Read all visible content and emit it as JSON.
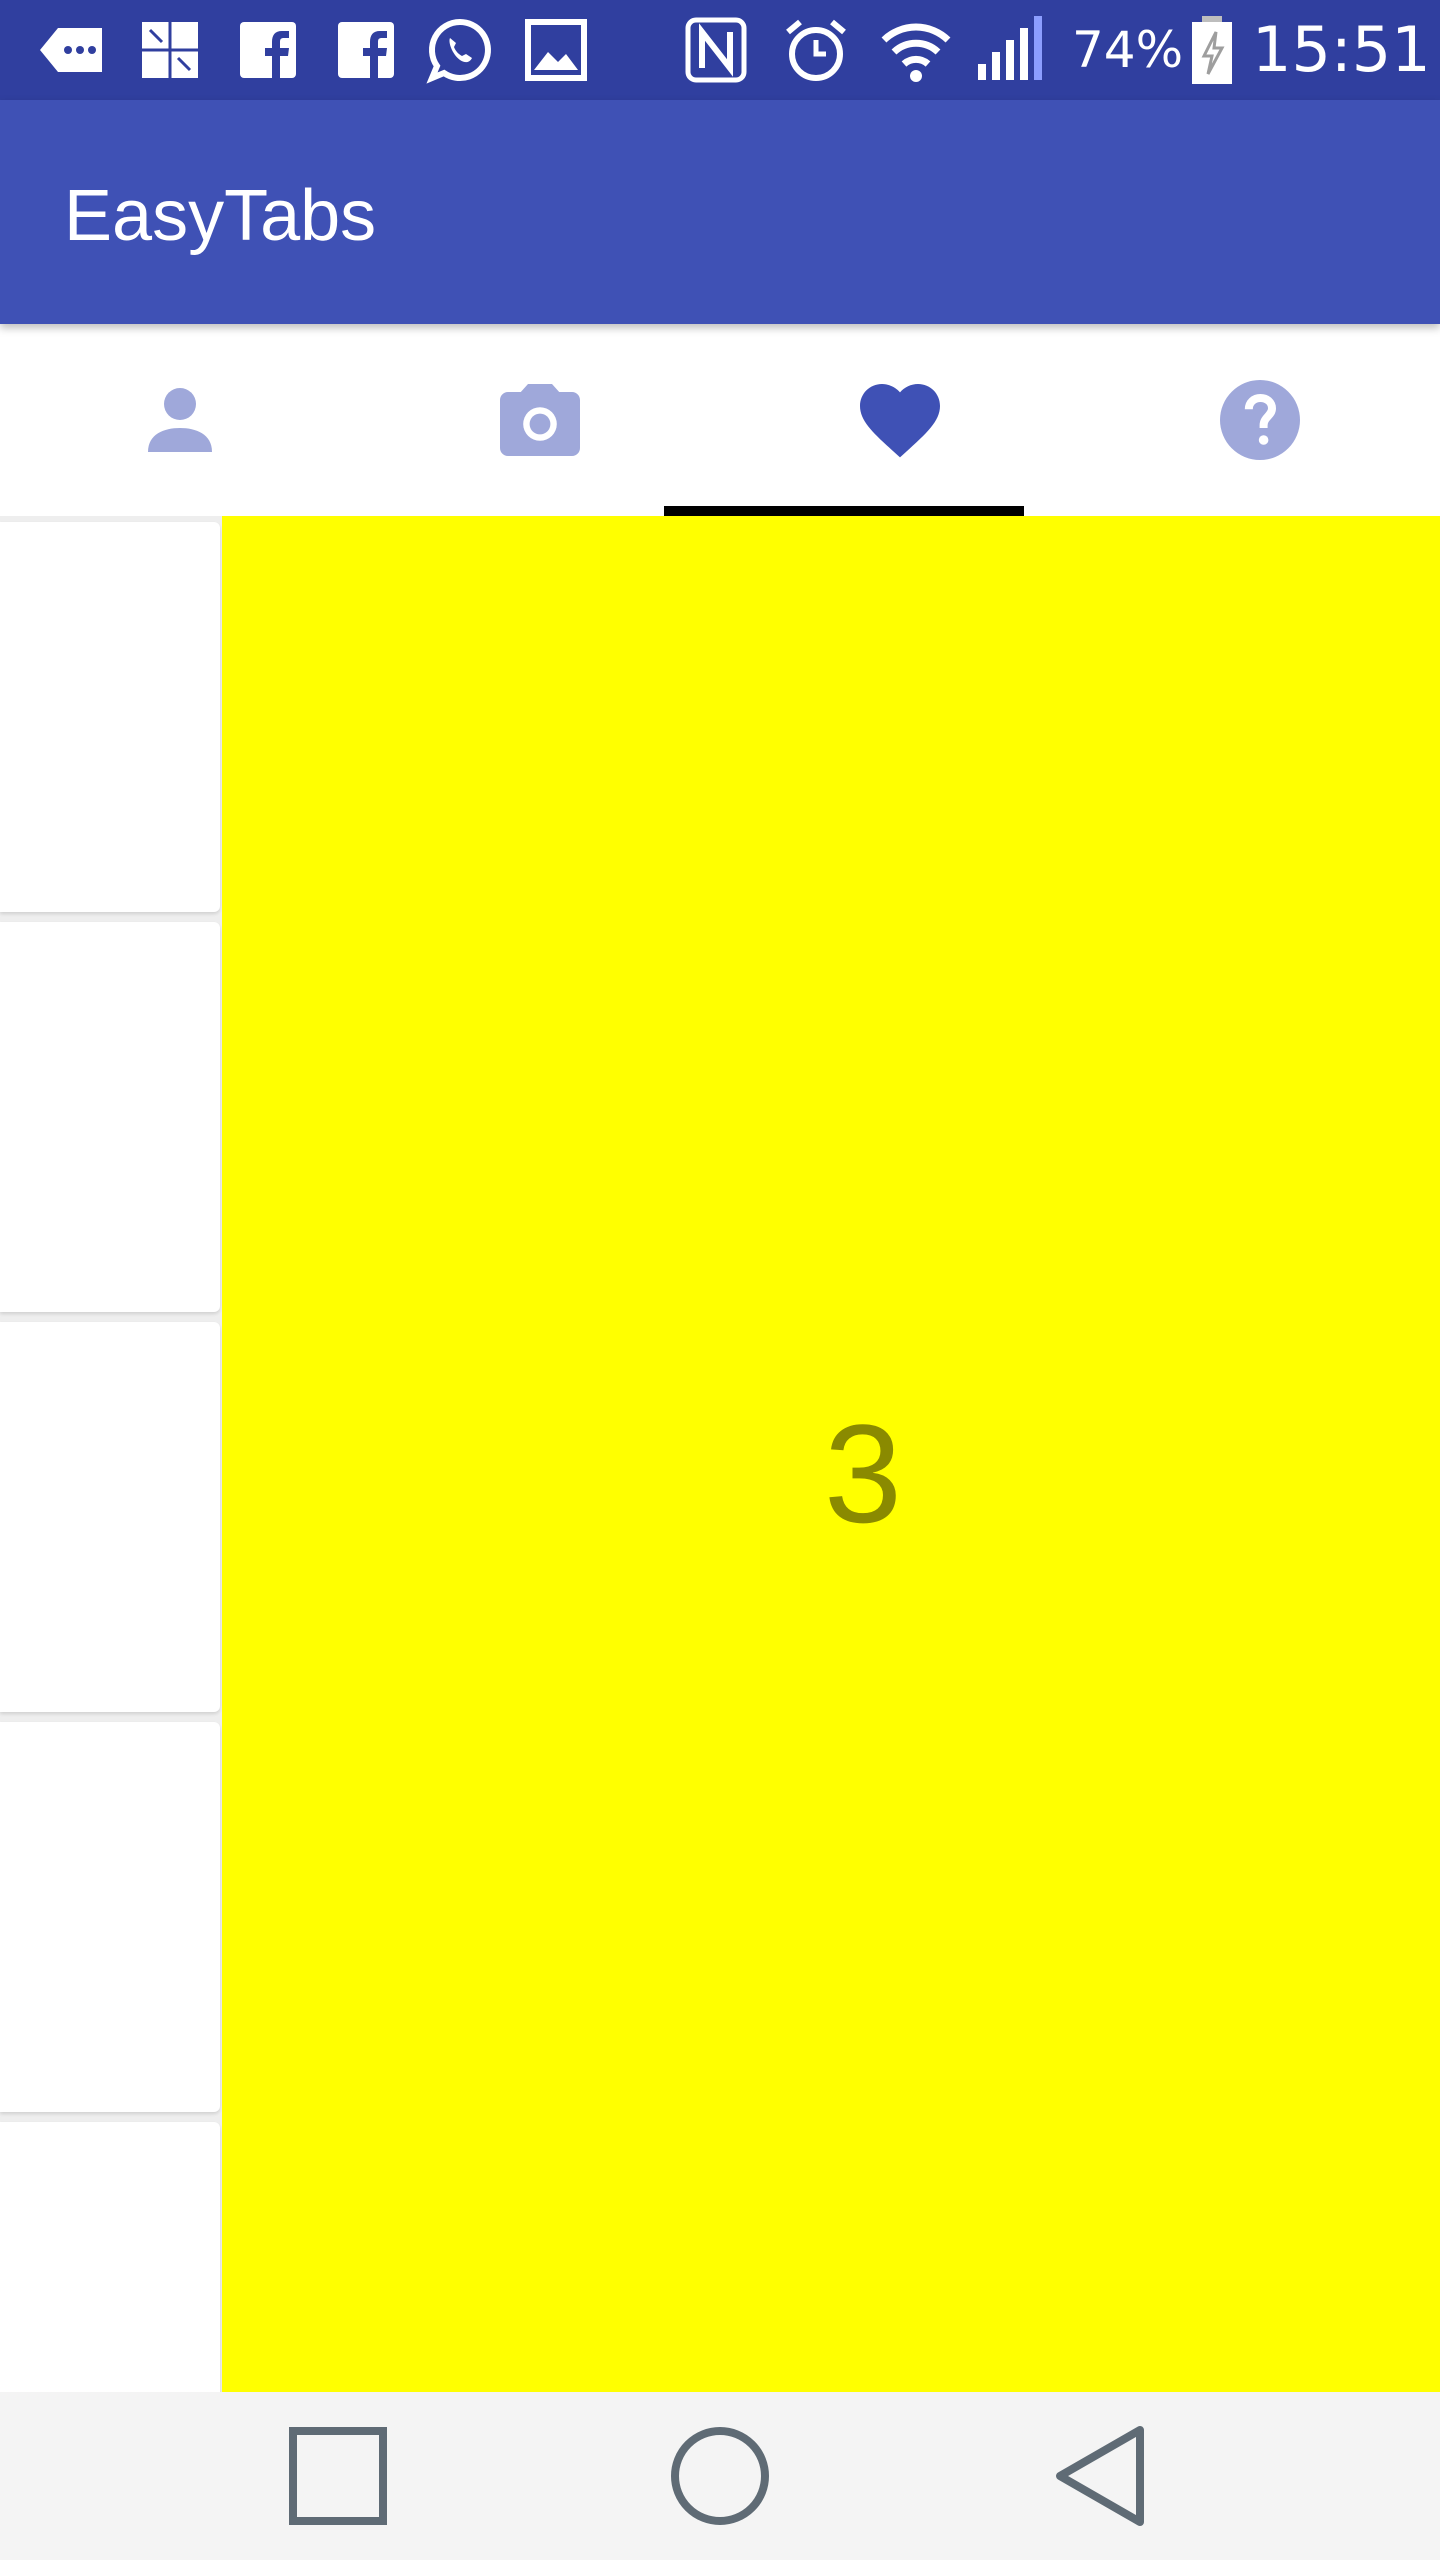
{
  "status_bar": {
    "battery_percent": "74%",
    "time": "15:51",
    "icons": [
      "message-more-icon",
      "quilt-icon",
      "facebook-icon",
      "facebook-icon",
      "whatsapp-icon",
      "image-icon",
      "nfc-icon",
      "alarm-icon",
      "wifi-icon",
      "signal-icon",
      "battery-charging-icon"
    ]
  },
  "app_bar": {
    "title": "EasyTabs"
  },
  "tabs": [
    {
      "icon": "person-icon",
      "selected": false
    },
    {
      "icon": "camera-icon",
      "selected": false
    },
    {
      "icon": "heart-icon",
      "selected": true
    },
    {
      "icon": "help-icon",
      "selected": false
    }
  ],
  "page": {
    "label": "3",
    "background": "#ffff00"
  },
  "colors": {
    "primary": "#3f51b5",
    "primary_dark": "#303f9f",
    "tab_icon_active": "#3f51b5",
    "tab_icon_inactive": "#9fa8da",
    "indicator": "#000000"
  },
  "nav_bar": {
    "buttons": [
      "recents-icon",
      "home-icon",
      "back-icon"
    ]
  }
}
